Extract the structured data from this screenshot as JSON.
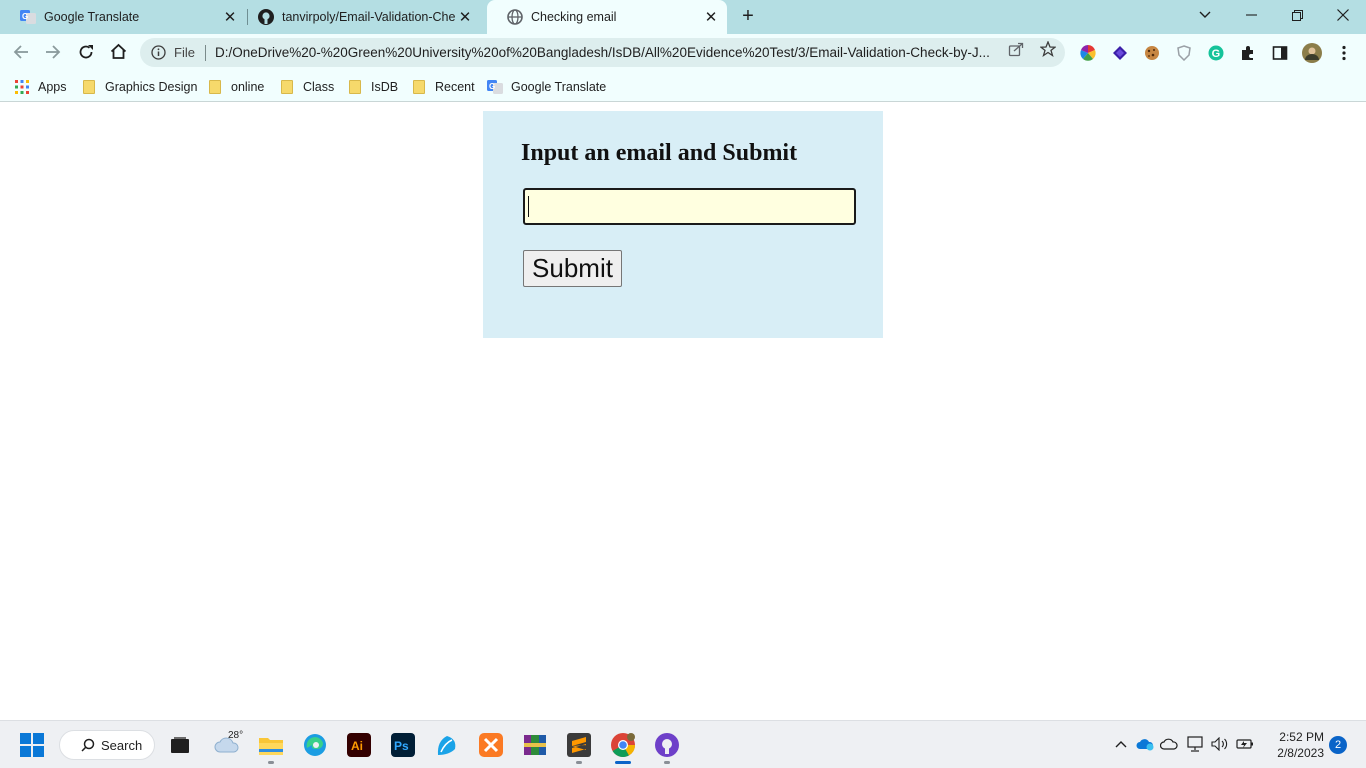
{
  "browser": {
    "tabs": [
      {
        "title": "Google Translate",
        "icon": "google-translate-icon",
        "active": false
      },
      {
        "title": "tanvirpoly/Email-Validation-Check-by-JavaScript",
        "icon": "github-icon",
        "active": false
      },
      {
        "title": "Checking email",
        "icon": "globe-icon",
        "active": true
      }
    ],
    "address_bar": {
      "scheme_label": "File",
      "url": "D:/OneDrive%20-%20Green%20University%20of%20Bangladesh/IsDB/All%20Evidence%20Test/3/Email-Validation-Check-by-J..."
    },
    "bookmarks": [
      {
        "label": "Apps",
        "icon": "apps-grid-icon"
      },
      {
        "label": "Graphics Design",
        "icon": "folder-icon"
      },
      {
        "label": "online",
        "icon": "folder-icon"
      },
      {
        "label": "Class",
        "icon": "folder-icon"
      },
      {
        "label": "IsDB",
        "icon": "folder-icon"
      },
      {
        "label": "Recent",
        "icon": "folder-icon"
      },
      {
        "label": "Google Translate",
        "icon": "google-translate-icon"
      }
    ]
  },
  "page": {
    "heading": "Input an email and Submit",
    "email_input": {
      "value": "",
      "placeholder": ""
    },
    "submit_label": "Submit"
  },
  "taskbar": {
    "search_label": "Search",
    "weather_temp": "28°",
    "clock_time": "2:52 PM",
    "clock_date": "2/8/2023",
    "notification_count": "2"
  },
  "colors": {
    "tab_strip": "#b4dee3",
    "toolbar": "#f1fefe",
    "card_background": "#d8eef6",
    "input_background": "#ffffe0"
  }
}
